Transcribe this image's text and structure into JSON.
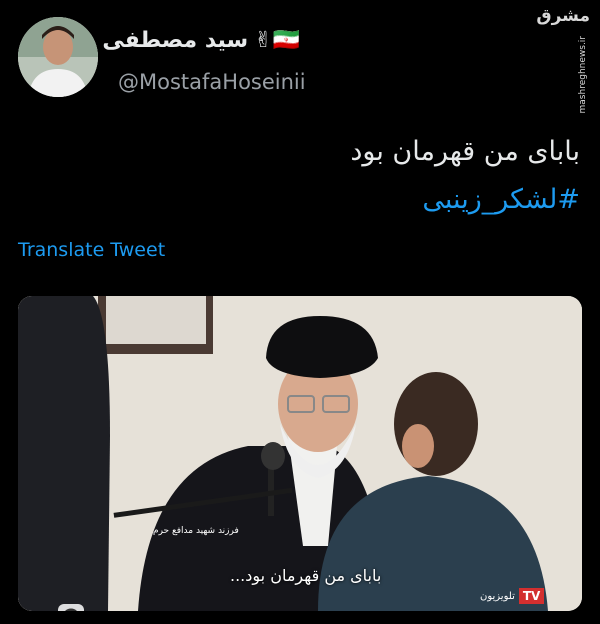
{
  "author": {
    "display_name": "سید مصطفی",
    "emoji": "🇮🇷✌",
    "handle": "@MostafaHoseinii"
  },
  "watermark": {
    "logo_text": "مشرق",
    "site": "mashreghnews.ir"
  },
  "tweet": {
    "text": "بابای من قهرمان بود",
    "hashtag": "#لشکر_زینبی",
    "translate_label": "Translate Tweet"
  },
  "media": {
    "subtitle": "بابای من قهرمان بود...",
    "lower_third": "فرزند شهید مدافع حرم",
    "channel_badge": "TV",
    "channel_name": "تلویزیون",
    "colors": {
      "tv_red": "#d32f2f"
    }
  },
  "colors": {
    "background": "#000000",
    "link": "#1d9bf0",
    "text": "#e7e9ea"
  }
}
